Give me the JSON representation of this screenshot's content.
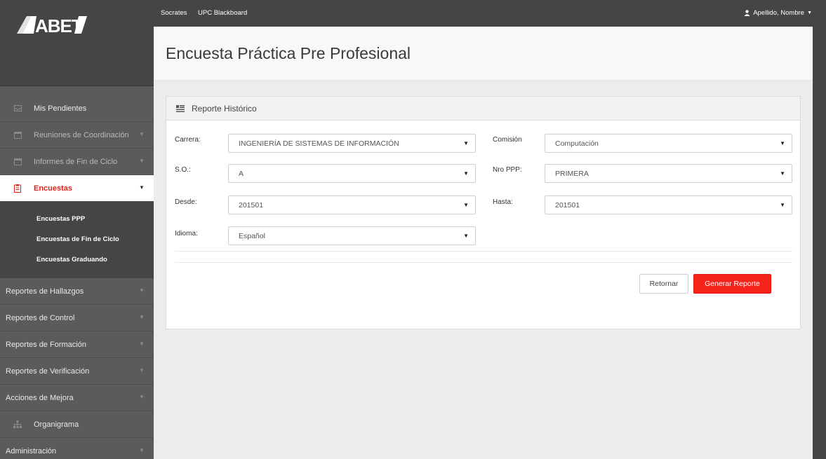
{
  "logo": {
    "text": "ABET"
  },
  "topbar": {
    "links": [
      "Socrates",
      "UPC Blackboard"
    ],
    "user_label": "Apellido, Nombre"
  },
  "sidebar": {
    "items": [
      {
        "label": "Mis Pendientes",
        "icon": "inbox-icon",
        "caret": false
      },
      {
        "label": "Reuniones de Coordinación",
        "icon": "calendar-icon",
        "caret": true
      },
      {
        "label": "Informes de Fin de Ciclo",
        "icon": "calendar-icon",
        "caret": true
      },
      {
        "label": "Encuestas",
        "icon": "clipboard-icon",
        "caret": true,
        "active": true
      },
      {
        "label": "Reportes de Hallazgos",
        "caret": true
      },
      {
        "label": "Reportes de Control",
        "caret": true
      },
      {
        "label": "Reportes de Formación",
        "caret": true
      },
      {
        "label": "Reportes de Verificación",
        "caret": true
      },
      {
        "label": "Acciones de Mejora",
        "caret": true
      },
      {
        "label": "Organigrama",
        "icon": "sitemap-icon",
        "caret": false
      },
      {
        "label": "Administración",
        "caret": true
      }
    ],
    "sub_items": [
      "Encuestas PPP",
      "Encuestas de Fin de Ciclo",
      "Encuestas Graduando"
    ]
  },
  "page": {
    "title": "Encuesta Práctica Pre Profesional"
  },
  "panel": {
    "title": "Reporte Histórico",
    "fields": {
      "carrera": {
        "label": "Carrera:",
        "value": "INGENIERÍA DE SISTEMAS DE INFORMACIÓN"
      },
      "comision": {
        "label": "Comisión",
        "value": "Computación"
      },
      "so": {
        "label": "S.O.:",
        "value": "A"
      },
      "nro_ppp": {
        "label": "Nro PPP:",
        "value": "PRIMERA"
      },
      "desde": {
        "label": "Desde:",
        "value": "201501"
      },
      "hasta": {
        "label": "Hasta:",
        "value": "201501"
      },
      "idioma": {
        "label": "Idioma:",
        "value": "Español"
      }
    },
    "buttons": {
      "return_label": "Retornar",
      "generate_label": "Generar Reporte"
    }
  },
  "colors": {
    "accent": "#f5231b",
    "sidebar": "#5b5b5b",
    "topbar": "#454545"
  }
}
